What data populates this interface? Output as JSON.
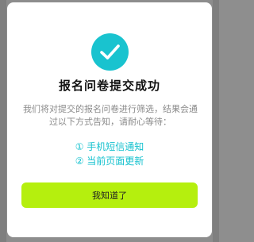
{
  "dialog": {
    "title": "报名问卷提交成功",
    "description": "我们将对提交的报名问卷进行筛选，结果会通过以下方式告知，请耐心等待：",
    "methods": [
      "① 手机短信通知",
      "② 当前页面更新"
    ],
    "confirm_label": "我知道了",
    "icon": "check-circle-icon"
  },
  "colors": {
    "accent": "#19c3cf",
    "button": "#b5ef0e",
    "overlay": "#8d8d8d"
  }
}
